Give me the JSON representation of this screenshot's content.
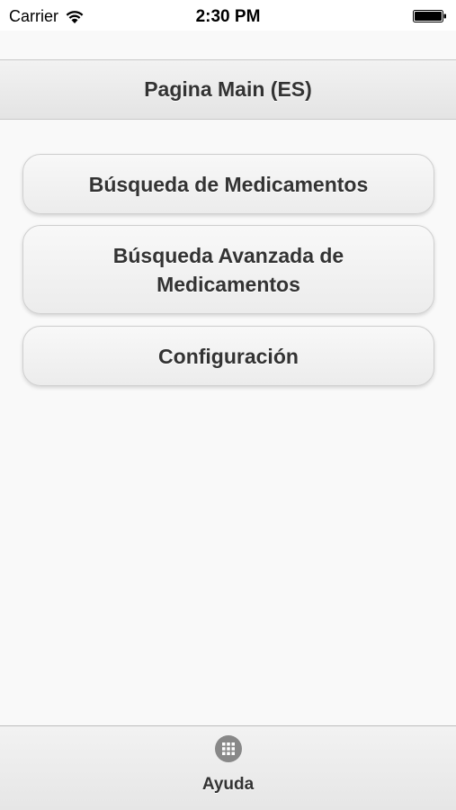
{
  "status_bar": {
    "carrier": "Carrier",
    "time": "2:30 PM"
  },
  "header": {
    "title": "Pagina Main (ES)"
  },
  "menu": {
    "items": [
      {
        "label": "Búsqueda de Medicamentos"
      },
      {
        "label": "Búsqueda Avanzada de Medicamentos"
      },
      {
        "label": "Configuración"
      }
    ]
  },
  "footer": {
    "tab_label": "Ayuda",
    "tab_icon": "grid-icon"
  },
  "colors": {
    "text": "#333333",
    "background": "#f9f9f9",
    "icon": "#888888"
  }
}
